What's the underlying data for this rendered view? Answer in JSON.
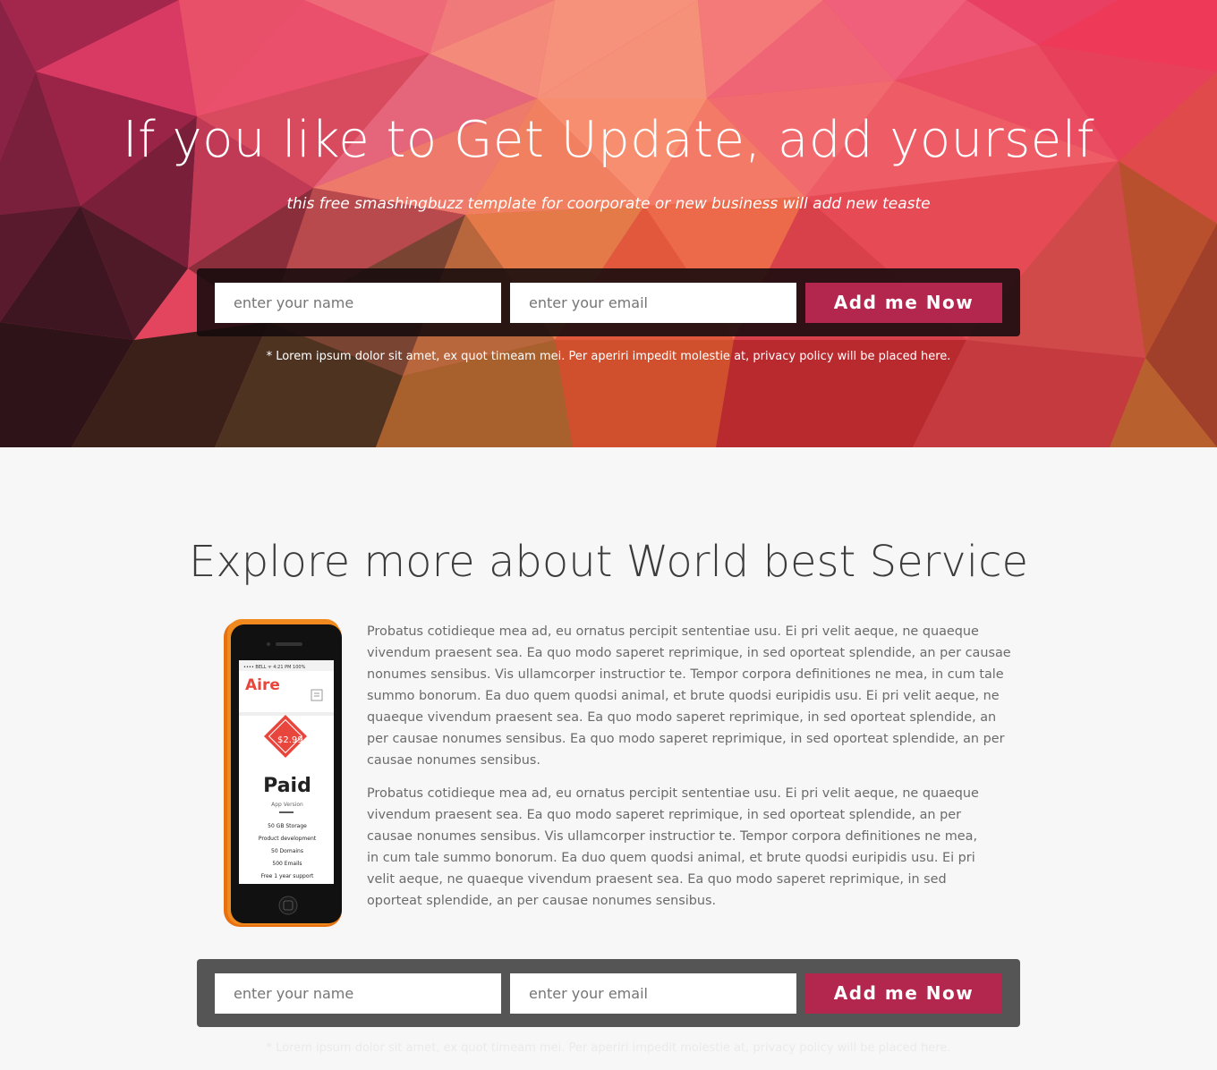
{
  "hero": {
    "title": "If you like to Get Update, add yourself",
    "subtitle": "this free smashingbuzz template for coorporate or new business will add new teaste",
    "form": {
      "name_placeholder": "enter your name",
      "email_placeholder": "enter your email",
      "button_label": "Add me Now"
    },
    "note": "* Lorem ipsum dolor sit amet, ex quot timeam mei. Per aperiri impedit molestie at, privacy policy will be placed here."
  },
  "services": {
    "title": "Explore more about World best Service",
    "paragraph_1": "Probatus cotidieque mea ad, eu ornatus percipit sententiae usu. Ei pri velit aeque, ne quaeque vivendum praesent sea. Ea quo modo saperet reprimique, in sed oporteat splendide, an per causae nonumes sensi­bus. Vis ullamcorper instructior te. Tempor corpora definitiones ne mea, in cum tale summo bonorum. Ea duo quem quodsi animal, et brute quodsi euripidis usu. Ei pri velit aeque, ne quaeque vivendum praesent sea. Ea quo modo saperet reprimique, in sed oporteat splendide, an per causae nonumes sensibus. Ea quo modo saperet reprimique, in sed oporteat splendide, an per causae nonumes sensibus.",
    "paragraph_2": "Probatus cotidieque mea ad, eu ornatus percipit sententiae usu. Ei pri velit aeque, ne quaeque viven­dum praesent sea. Ea quo modo saperet reprimique, in sed oporteat splendide, an per causae non­umes sensibus. Vis ullamcorper instructior te. Tempor corpora definitiones ne mea, in cum tale summo bonorum. Ea duo quem quodsi animal, et brute quodsi euripidis usu. Ei pri velit aeque, ne quaeque vivendum praesent sea. Ea quo modo saperet reprimique, in sed oporteat splendide, an per causae nonumes sensibus.",
    "phone": {
      "status": "•••• BELL  ᯤ      4:21 PM        100%",
      "app_logo": "Aire",
      "price": "$2.99",
      "plan": "Paid",
      "plan_sub": "App Version",
      "features": [
        "50 GB Storage",
        "Product development",
        "50 Domains",
        "500 Emails",
        "Free 1 year support"
      ]
    }
  },
  "bottom_form": {
    "name_placeholder": "enter your name",
    "email_placeholder": "enter your email",
    "button_label": "Add me Now",
    "note": "* Lorem ipsum dolor sit amet, ex quot timeam mei. Per aperiri impedit molestie at, privacy policy will be placed here."
  },
  "colors": {
    "accent": "#b3264e",
    "hero_base": "#e4455e",
    "text": "#6b6b6b",
    "title": "#3c3c3c"
  }
}
